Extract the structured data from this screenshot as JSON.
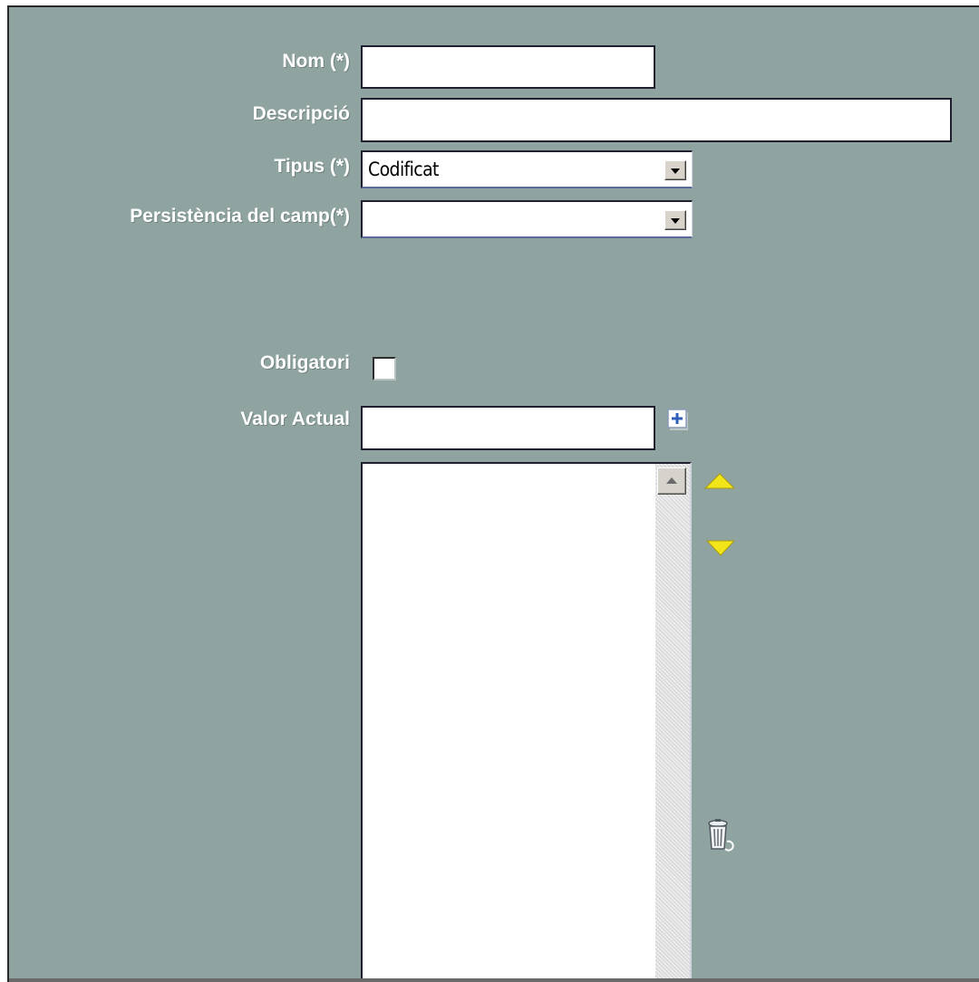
{
  "form": {
    "nom_label": "Nom (*)",
    "nom_value": "",
    "descripcio_label": "Descripció",
    "descripcio_value": "",
    "tipus_label": "Tipus (*)",
    "tipus_selected": "Codificat",
    "persistencia_label": "Persistència del camp(*)",
    "persistencia_selected": "",
    "obligatori_label": "Obligatori",
    "obligatori_checked": false,
    "valor_actual_label": "Valor Actual",
    "valor_actual_value": ""
  },
  "icons": {
    "add": "plus-box-icon",
    "move_up": "triangle-up-icon",
    "move_down": "triangle-down-icon",
    "delete": "trash-can-icon",
    "scroll_up": "scroll-up-arrow-icon",
    "dropdown": "dropdown-arrow-icon"
  },
  "colors": {
    "background": "#8fa4a1",
    "arrow_yellow": "#f2e61a",
    "label_text": "#ffffff"
  },
  "values_list": []
}
